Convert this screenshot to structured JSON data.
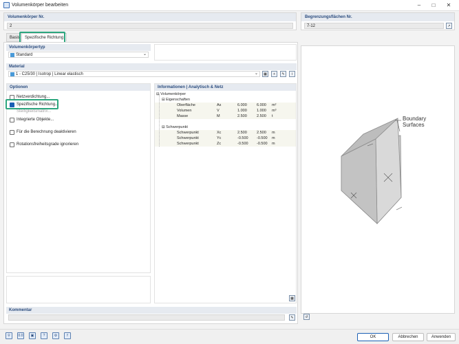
{
  "window": {
    "title": "Volumenkörper bearbeiten"
  },
  "header": {
    "nr_label": "Volumenkörper Nr.",
    "nr_value": "2",
    "boundary_label": "Begrenzungsflächen Nr.",
    "boundary_value": "7-12"
  },
  "tabs": [
    {
      "label": "Basis"
    },
    {
      "label": "Spezifische Richtung"
    }
  ],
  "solid_type": {
    "label": "Volumenkörpertyp",
    "value": "Standard"
  },
  "material": {
    "label": "Material",
    "value": "1 - C25/30 | Isotrop | Linear elastisch"
  },
  "options": {
    "label": "Optionen",
    "items": [
      {
        "label": "Netzverdichtung...",
        "checked": false
      },
      {
        "label": "Spezifische Richtung...",
        "checked": true
      },
      {
        "label": "Steifigkeitsmatrix...",
        "checked": false
      },
      {
        "label": "Integrierte Objekte...",
        "checked": false
      },
      {
        "label": "Für die Berechnung deaktivieren",
        "checked": false
      },
      {
        "label": "Rotationsfreiheitsgrade ignorieren",
        "checked": false
      }
    ]
  },
  "info": {
    "label": "Informationen | Analytisch & Netz",
    "root": "Volumenkörper",
    "group1": "Eigenschaften",
    "props": [
      {
        "name": "Oberfläche",
        "sym": "As",
        "v1": "6.000",
        "v2": "6.000",
        "unit": "m²"
      },
      {
        "name": "Volumen",
        "sym": "V",
        "v1": "1.000",
        "v2": "1.000",
        "unit": "m³"
      },
      {
        "name": "Masse",
        "sym": "M",
        "v1": "2.500",
        "v2": "2.500",
        "unit": "t"
      }
    ],
    "group2": "Schwerpunkt",
    "centroid": [
      {
        "name": "Schwerpunkt",
        "sym": "Xc",
        "v1": "2.500",
        "v2": "2.500",
        "unit": "m"
      },
      {
        "name": "Schwerpunkt",
        "sym": "Yc",
        "v1": "-0.500",
        "v2": "-0.500",
        "unit": "m"
      },
      {
        "name": "Schwerpunkt",
        "sym": "Zc",
        "v1": "-0.500",
        "v2": "-0.500",
        "unit": "m"
      }
    ]
  },
  "preview": {
    "annotation": "Boundary\nSurfaces"
  },
  "comment": {
    "label": "Kommentar",
    "value": ""
  },
  "buttons": {
    "ok": "OK",
    "cancel": "Abbrechen",
    "apply": "Anwenden"
  },
  "colors": {
    "accent": "#1a5fb4",
    "highlight": "#2aa57d",
    "header_text": "#2b4c7e"
  }
}
